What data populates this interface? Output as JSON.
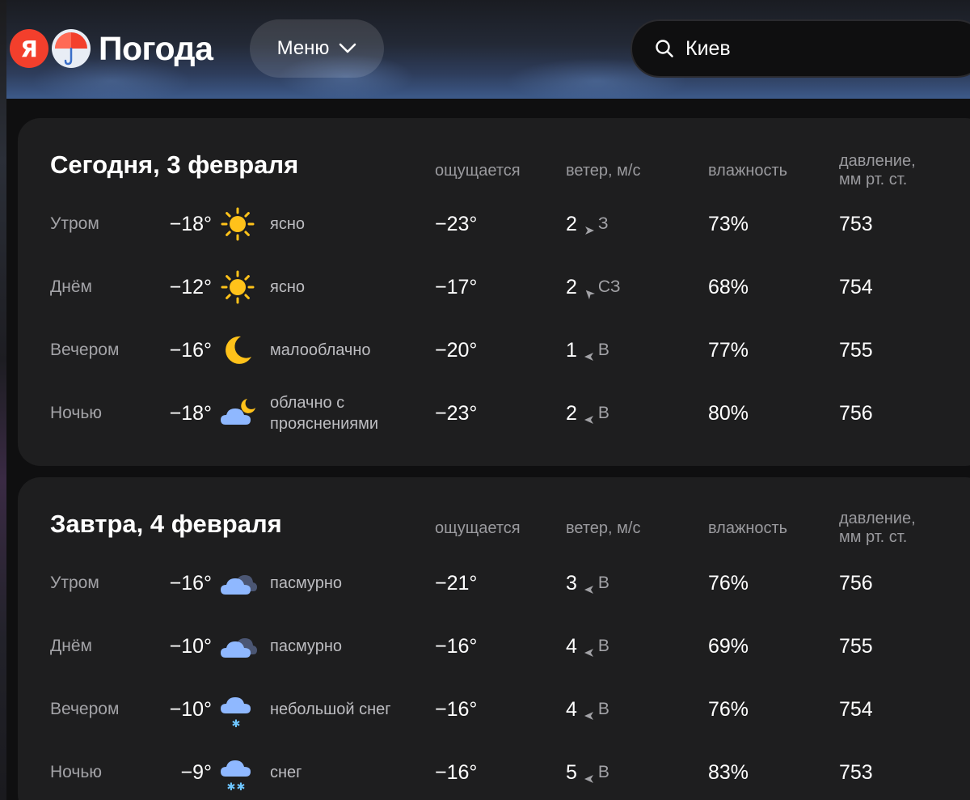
{
  "header": {
    "logo_letter": "Я",
    "logo_text": "Погода",
    "menu_label": "Меню",
    "search_value": "Киев"
  },
  "columns": {
    "feels": "ощущается",
    "wind": "ветер, м/с",
    "humidity": "влажность",
    "pressure_line1": "давление,",
    "pressure_line2": "мм рт. ст."
  },
  "today": {
    "title": "Сегодня, 3 февраля",
    "rows": [
      {
        "time": "Утром",
        "temp": "−18°",
        "icon": "sun-icon",
        "cond": "ясно",
        "feels": "−23°",
        "wind_speed": "2",
        "wind_dir": "З",
        "wind_arrow": "east-arrow",
        "humidity": "73%",
        "pressure": "753"
      },
      {
        "time": "Днём",
        "temp": "−12°",
        "icon": "sun-icon",
        "cond": "ясно",
        "feels": "−17°",
        "wind_speed": "2",
        "wind_dir": "СЗ",
        "wind_arrow": "southeast-arrow",
        "humidity": "68%",
        "pressure": "754"
      },
      {
        "time": "Вечером",
        "temp": "−16°",
        "icon": "moon-icon",
        "cond": "малооблачно",
        "feels": "−20°",
        "wind_speed": "1",
        "wind_dir": "В",
        "wind_arrow": "west-arrow",
        "humidity": "77%",
        "pressure": "755"
      },
      {
        "time": "Ночью",
        "temp": "−18°",
        "icon": "cloud-moon-icon",
        "cond": "облачно с прояснениями",
        "feels": "−23°",
        "wind_speed": "2",
        "wind_dir": "В",
        "wind_arrow": "west-arrow",
        "humidity": "80%",
        "pressure": "756"
      }
    ]
  },
  "tomorrow": {
    "title": "Завтра, 4 февраля",
    "rows": [
      {
        "time": "Утром",
        "temp": "−16°",
        "icon": "overcast-icon",
        "cond": "пасмурно",
        "feels": "−21°",
        "wind_speed": "3",
        "wind_dir": "В",
        "wind_arrow": "west-arrow",
        "humidity": "76%",
        "pressure": "756"
      },
      {
        "time": "Днём",
        "temp": "−10°",
        "icon": "overcast-icon",
        "cond": "пасмурно",
        "feels": "−16°",
        "wind_speed": "4",
        "wind_dir": "В",
        "wind_arrow": "west-arrow",
        "humidity": "69%",
        "pressure": "755"
      },
      {
        "time": "Вечером",
        "temp": "−10°",
        "icon": "light-snow-icon",
        "cond": "небольшой снег",
        "feels": "−16°",
        "wind_speed": "4",
        "wind_dir": "В",
        "wind_arrow": "west-arrow",
        "humidity": "76%",
        "pressure": "754"
      },
      {
        "time": "Ночью",
        "temp": "−9°",
        "icon": "snow-icon",
        "cond": "снег",
        "feels": "−16°",
        "wind_speed": "5",
        "wind_dir": "В",
        "wind_arrow": "west-arrow",
        "humidity": "83%",
        "pressure": "753"
      }
    ]
  },
  "colors": {
    "card_bg": "#1e1e1f",
    "brand_red": "#f33f2c",
    "sun": "#ffc21a",
    "cloud": "#8fb8ff"
  }
}
